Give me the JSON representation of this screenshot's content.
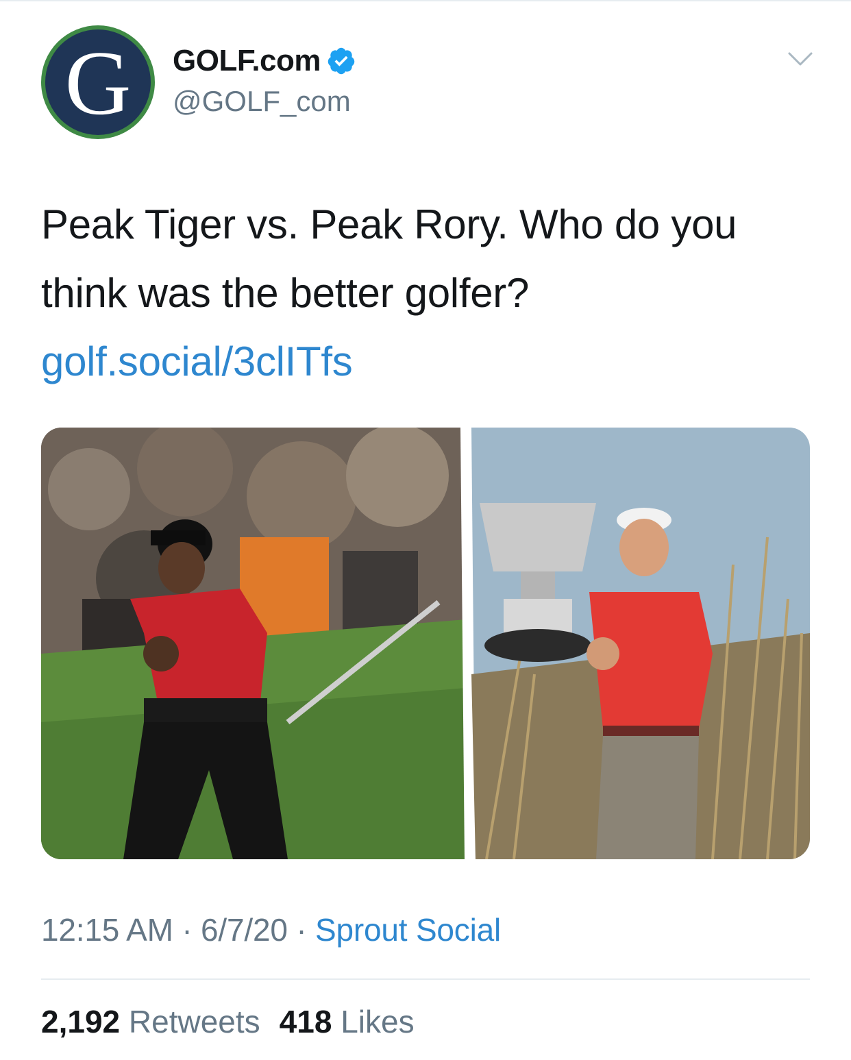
{
  "account": {
    "display_name": "GOLF.com",
    "handle": "@GOLF_com",
    "avatar_letter": "G",
    "verified": true
  },
  "tweet": {
    "text": "Peak Tiger vs. Peak Rory. Who do you think was the better golfer?",
    "link": "golf.social/3clITfs"
  },
  "meta": {
    "time": "12:15 AM",
    "sep1": " · ",
    "date": "6/7/20",
    "sep2": " · ",
    "source": "Sprout Social"
  },
  "stats": {
    "retweets_count": "2,192",
    "retweets_label": "Retweets",
    "likes_count": "418",
    "likes_label": "Likes"
  },
  "colors": {
    "link": "#2e87cf",
    "secondary_text": "#657786",
    "verified_badge": "#1da1f2",
    "avatar_ring": "#3f8a45",
    "avatar_fill": "#1f3556"
  },
  "icons": {
    "verified": "verified-badge-icon",
    "more": "chevron-down-icon"
  }
}
